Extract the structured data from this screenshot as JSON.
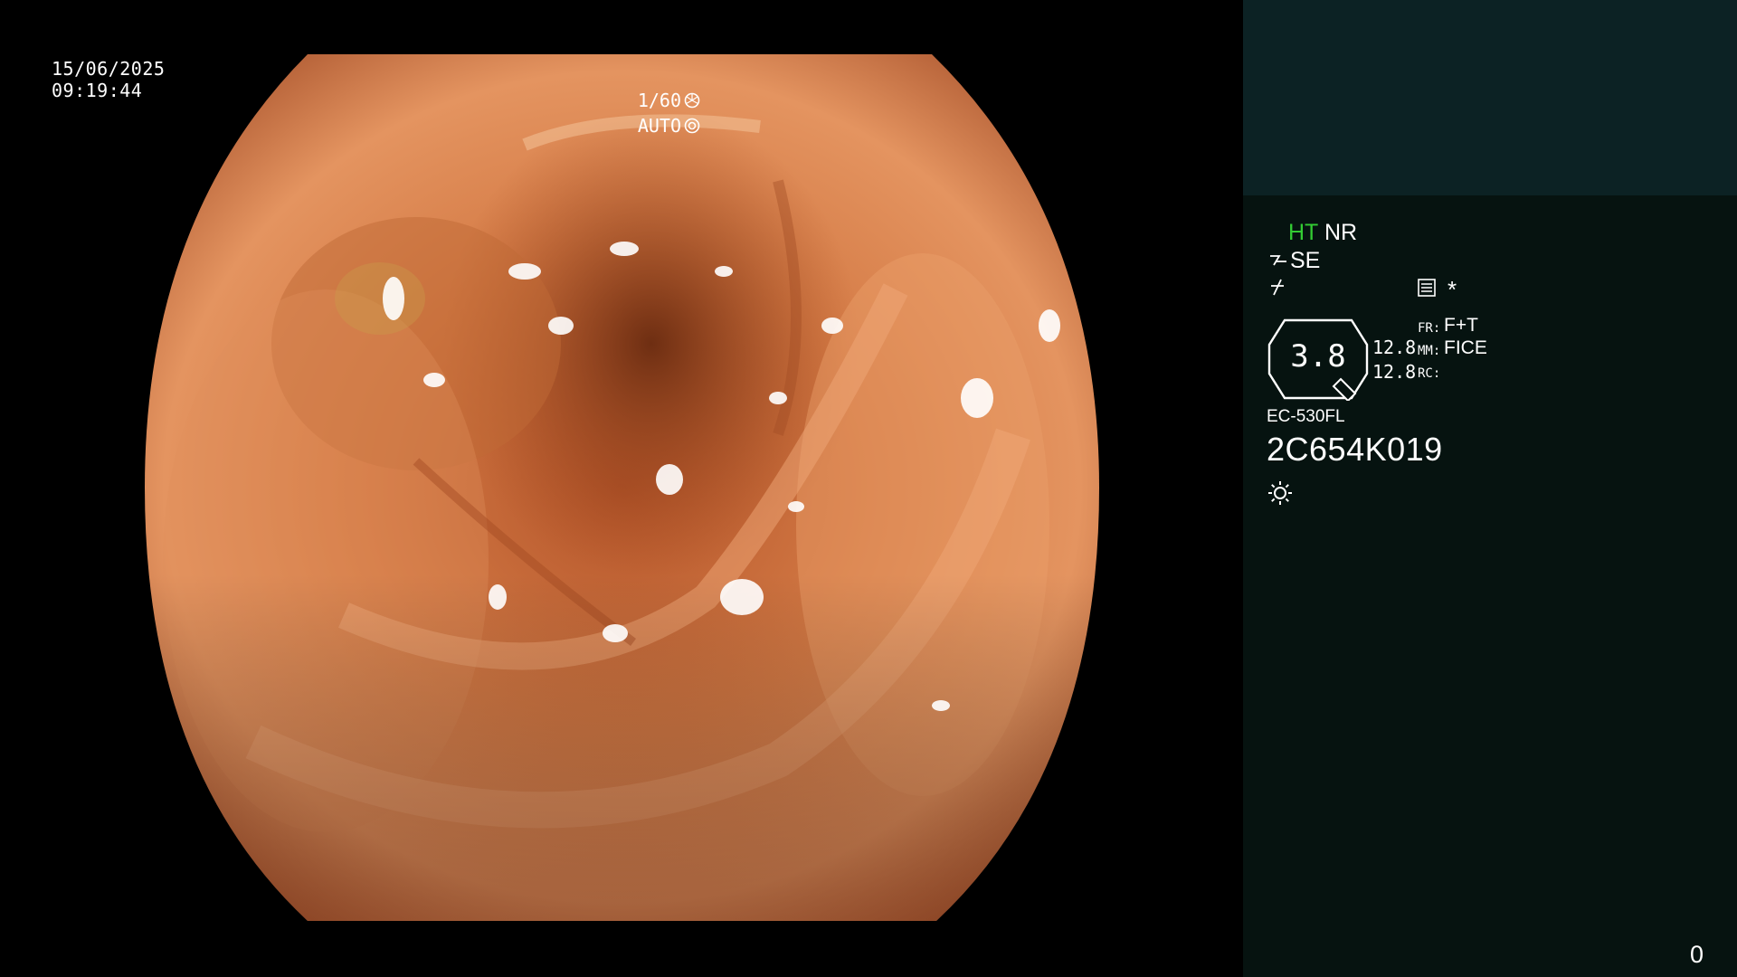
{
  "overlay": {
    "date": "15/06/2025",
    "time": "09:19:44",
    "shutter": "1/60",
    "iris_mode": "AUTO",
    "shutter_icon": "shutter-icon",
    "iris_icon": "iris-icon"
  },
  "panel": {
    "ht_label": "HT",
    "nr_label": "NR",
    "se_label": "SE",
    "zoom_value": "3.8",
    "value_1": "12.8",
    "value_2": "12.8",
    "fr_label": "FR:",
    "fr_value": "F+T",
    "mm_label": "MM:",
    "mm_value": "FICE",
    "rc_label": "RC:",
    "star_symbol": "*",
    "model": "EC-530FL",
    "serial": "2C654K019",
    "counter": "0",
    "ht_color": "#33cc33",
    "panel_bg": "#061310",
    "panel_top_bg": "#0c2224"
  }
}
